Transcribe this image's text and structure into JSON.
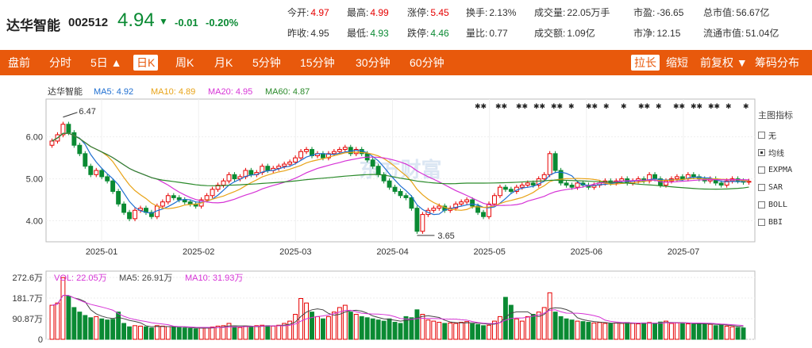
{
  "stock": {
    "name": "达华智能",
    "code": "002512",
    "price": "4.94",
    "arrow": "▼",
    "change": "-0.01",
    "change_pct": "-0.20%"
  },
  "quotes": [
    {
      "label": "今开:",
      "value": "4.97",
      "color": "red"
    },
    {
      "label": "最高:",
      "value": "4.99",
      "color": "red"
    },
    {
      "label": "涨停:",
      "value": "5.45",
      "color": "red"
    },
    {
      "label": "换手:",
      "value": "2.13%",
      "color": "none"
    },
    {
      "label": "成交量:",
      "value": "22.05万手",
      "color": "none"
    },
    {
      "label": "市盈:",
      "value": "-36.65",
      "color": "none"
    },
    {
      "label": "总市值:",
      "value": "56.67亿",
      "color": "none"
    },
    {
      "label": "昨收:",
      "value": "4.95",
      "color": "none"
    },
    {
      "label": "最低:",
      "value": "4.93",
      "color": "green"
    },
    {
      "label": "跌停:",
      "value": "4.46",
      "color": "green"
    },
    {
      "label": "量比:",
      "value": "0.77",
      "color": "none"
    },
    {
      "label": "成交额:",
      "value": "1.09亿",
      "color": "none"
    },
    {
      "label": "市净:",
      "value": "12.15",
      "color": "none"
    },
    {
      "label": "流通市值:",
      "value": "51.04亿",
      "color": "none"
    }
  ],
  "tabs": [
    "盘前",
    "分时",
    "5日 ▲",
    "日K",
    "周K",
    "月K",
    "5分钟",
    "15分钟",
    "30分钟",
    "60分钟"
  ],
  "active_tab": "日K",
  "right_tabs": [
    "拉长",
    "缩短",
    "前复权 ▼",
    "筹码分布"
  ],
  "active_right_tab": "拉长",
  "indicators": {
    "title": "主图指标",
    "options": [
      {
        "label": "无",
        "checked": false
      },
      {
        "label": "均线",
        "checked": true
      },
      {
        "label": "EXPMA",
        "checked": false
      },
      {
        "label": "SAR",
        "checked": false
      },
      {
        "label": "BOLL",
        "checked": false
      },
      {
        "label": "BBI",
        "checked": false
      }
    ]
  },
  "watermark": "东方财富",
  "colors": {
    "up": "#e60000",
    "down": "#0a8a33",
    "ma5": "#1f6fd1",
    "ma10": "#e8a317",
    "ma20": "#d633d6",
    "ma60": "#2a8a2a",
    "accent": "#e8590c"
  },
  "chart_data": {
    "type": "candlestick",
    "legend": {
      "name": "达华智能",
      "MA5": "4.92",
      "MA10": "4.89",
      "MA20": "4.95",
      "MA60": "4.87"
    },
    "y_ticks": [
      "6.00",
      "5.00",
      "4.00"
    ],
    "ylim": [
      3.5,
      6.9
    ],
    "x_ticks": [
      "2025-01",
      "2025-02",
      "2025-03",
      "2025-04",
      "2025-05",
      "2025-06",
      "2025-07"
    ],
    "annotations": {
      "high": "6.47",
      "low": "3.65"
    },
    "star_groups": [
      3,
      9,
      2,
      2,
      2,
      1,
      2,
      1,
      1,
      2,
      1,
      2,
      2,
      2,
      1,
      1,
      1
    ],
    "volume": {
      "legend": {
        "VOL": "22.05万",
        "MA5": "26.91万",
        "MA10": "31.93万"
      },
      "y_ticks": [
        "272.6万",
        "181.7万",
        "90.87万",
        "0"
      ]
    },
    "close": [
      5.9,
      6.05,
      6.3,
      6.1,
      5.8,
      5.6,
      5.3,
      5.1,
      5.2,
      5.05,
      4.95,
      4.7,
      4.4,
      4.2,
      4.05,
      4.25,
      4.3,
      4.2,
      4.1,
      4.35,
      4.45,
      4.6,
      4.55,
      4.5,
      4.45,
      4.4,
      4.35,
      4.5,
      4.6,
      4.75,
      4.85,
      4.95,
      5.1,
      5.0,
      5.05,
      5.2,
      5.1,
      5.15,
      5.3,
      5.2,
      5.25,
      5.3,
      5.35,
      5.4,
      5.5,
      5.65,
      5.7,
      5.55,
      5.6,
      5.5,
      5.6,
      5.65,
      5.7,
      5.75,
      5.6,
      5.7,
      5.6,
      5.45,
      5.3,
      5.1,
      4.95,
      4.8,
      4.7,
      4.6,
      4.55,
      4.3,
      3.75,
      4.15,
      4.25,
      4.3,
      4.35,
      4.25,
      4.3,
      4.4,
      4.45,
      4.5,
      4.35,
      4.2,
      4.1,
      4.4,
      4.6,
      4.8,
      4.75,
      4.7,
      4.8,
      4.85,
      4.9,
      4.85,
      5.0,
      5.1,
      5.6,
      5.2,
      4.9,
      4.85,
      4.8,
      4.9,
      4.85,
      4.8,
      4.85,
      4.9,
      4.95,
      4.9,
      4.95,
      5.0,
      4.9,
      4.95,
      5.0,
      4.95,
      5.1,
      5.0,
      4.85,
      4.95,
      5.0,
      5.05,
      5.0,
      5.1,
      5.05,
      5.0,
      4.95,
      5.0,
      4.9,
      4.85,
      4.95,
      5.0,
      4.95,
      4.92,
      4.94
    ],
    "volumes": [
      150,
      160,
      272,
      190,
      140,
      120,
      105,
      95,
      100,
      90,
      85,
      88,
      120,
      70,
      55,
      60,
      58,
      55,
      50,
      60,
      58,
      56,
      54,
      52,
      50,
      48,
      46,
      50,
      52,
      54,
      58,
      60,
      70,
      55,
      52,
      58,
      55,
      60,
      62,
      60,
      58,
      62,
      70,
      80,
      110,
      180,
      160,
      120,
      100,
      90,
      100,
      120,
      140,
      150,
      120,
      110,
      100,
      95,
      90,
      85,
      80,
      90,
      75,
      70,
      100,
      95,
      130,
      110,
      85,
      80,
      75,
      70,
      72,
      70,
      75,
      78,
      68,
      65,
      60,
      62,
      80,
      100,
      185,
      150,
      90,
      80,
      100,
      110,
      120,
      140,
      205,
      120,
      100,
      90,
      85,
      80,
      78,
      75,
      72,
      74,
      70,
      68,
      72,
      70,
      74,
      70,
      68,
      72,
      74,
      70,
      76,
      80,
      70,
      72,
      70,
      68,
      66,
      70,
      68,
      66,
      60,
      62,
      58,
      55,
      52,
      50
    ]
  }
}
